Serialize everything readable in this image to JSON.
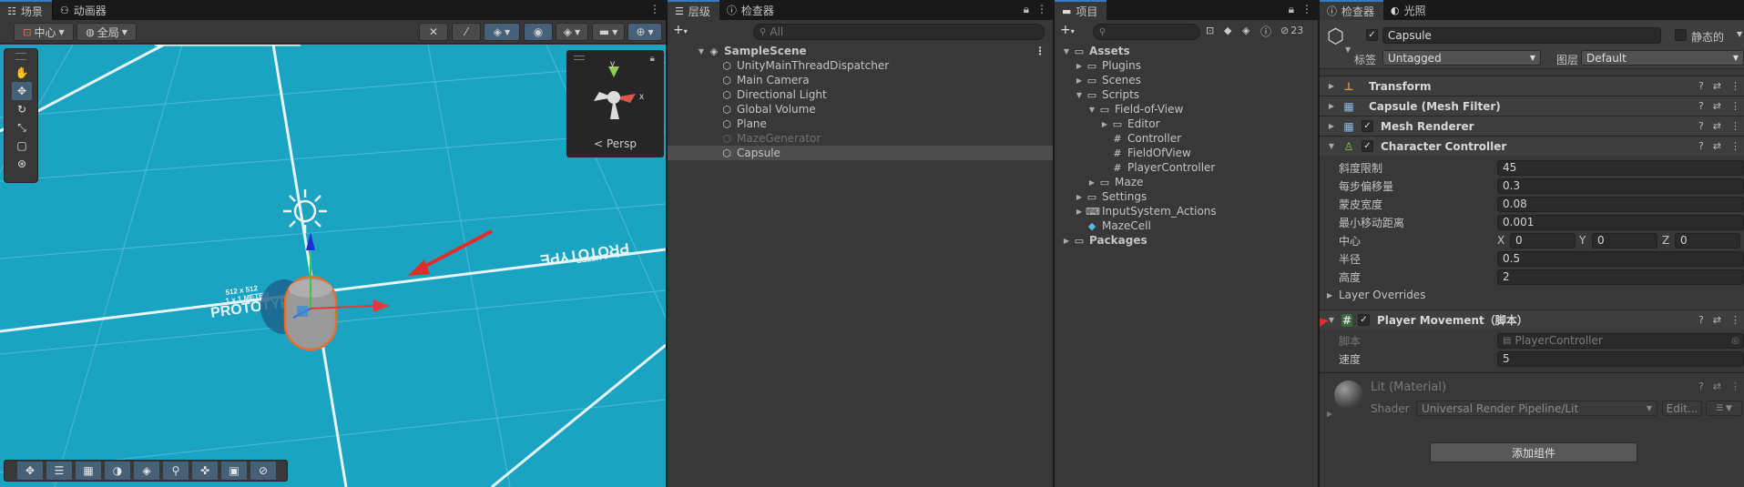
{
  "scene_panel": {
    "tabs": [
      {
        "label": "场景",
        "icon": "grid-icon"
      },
      {
        "label": "动画器",
        "icon": "animator-icon"
      }
    ],
    "pivot_label": "中心",
    "space_label": "全局",
    "persp_label": "Persp",
    "floor_texts": [
      "PROTOTYPE",
      "1 x 1 METER",
      "512 x 512"
    ]
  },
  "hierarchy_panel": {
    "tabs": [
      {
        "label": "层级"
      },
      {
        "label": "检查器"
      }
    ],
    "search_placeholder": "All",
    "scene_name": "SampleScene",
    "items": [
      {
        "label": "UnityMainThreadDispatcher",
        "state": "normal"
      },
      {
        "label": "Main Camera",
        "state": "normal"
      },
      {
        "label": "Directional Light",
        "state": "normal"
      },
      {
        "label": "Global Volume",
        "state": "normal"
      },
      {
        "label": "Plane",
        "state": "normal"
      },
      {
        "label": "MazeGenerator",
        "state": "disabled"
      },
      {
        "label": "Capsule",
        "state": "selected"
      }
    ]
  },
  "project_panel": {
    "tab_label": "项目",
    "badge_count": "23",
    "tree": [
      {
        "label": "Assets",
        "bold": true
      },
      {
        "label": "Plugins"
      },
      {
        "label": "Scenes"
      },
      {
        "label": "Scripts"
      },
      {
        "label": "Field-of-View"
      },
      {
        "label": "Editor"
      },
      {
        "label": "Controller"
      },
      {
        "label": "FieldOfView"
      },
      {
        "label": "PlayerController"
      },
      {
        "label": "Maze"
      },
      {
        "label": "Settings"
      },
      {
        "label": "InputSystem_Actions"
      },
      {
        "label": "MazeCell"
      },
      {
        "label": "Packages",
        "bold": true
      }
    ]
  },
  "inspector_panel": {
    "tabs": [
      {
        "label": "检查器"
      },
      {
        "label": "光照"
      }
    ],
    "object_name": "Capsule",
    "static_label": "静态的",
    "tag_label": "标签",
    "tag_value": "Untagged",
    "layer_label": "图层",
    "layer_value": "Default",
    "components": {
      "transform": "Transform",
      "mesh_filter": "Capsule (Mesh Filter)",
      "mesh_renderer": "Mesh Renderer",
      "character_controller": "Character Controller"
    },
    "cc_props": [
      {
        "label": "斜度限制",
        "value": "45"
      },
      {
        "label": "每步偏移量",
        "value": "0.3"
      },
      {
        "label": "蒙皮宽度",
        "value": "0.08"
      },
      {
        "label": "最小移动距离",
        "value": "0.001"
      }
    ],
    "center": {
      "label": "中心",
      "x_label": "X",
      "x": "0",
      "y_label": "Y",
      "y": "0",
      "z_label": "Z",
      "z": "0"
    },
    "radius": {
      "label": "半径",
      "value": "0.5"
    },
    "height": {
      "label": "高度",
      "value": "2"
    },
    "layer_overrides": "Layer Overrides",
    "player_movement": {
      "title": "Player Movement（脚本）",
      "script_label": "脚本",
      "script_value": "PlayerController",
      "speed_label": "速度",
      "speed_value": "5"
    },
    "material": {
      "name": "Lit (Material)",
      "shader_label": "Shader",
      "shader_value": "Universal Render Pipeline/Lit",
      "edit_label": "Edit..."
    },
    "add_component": "添加组件"
  }
}
